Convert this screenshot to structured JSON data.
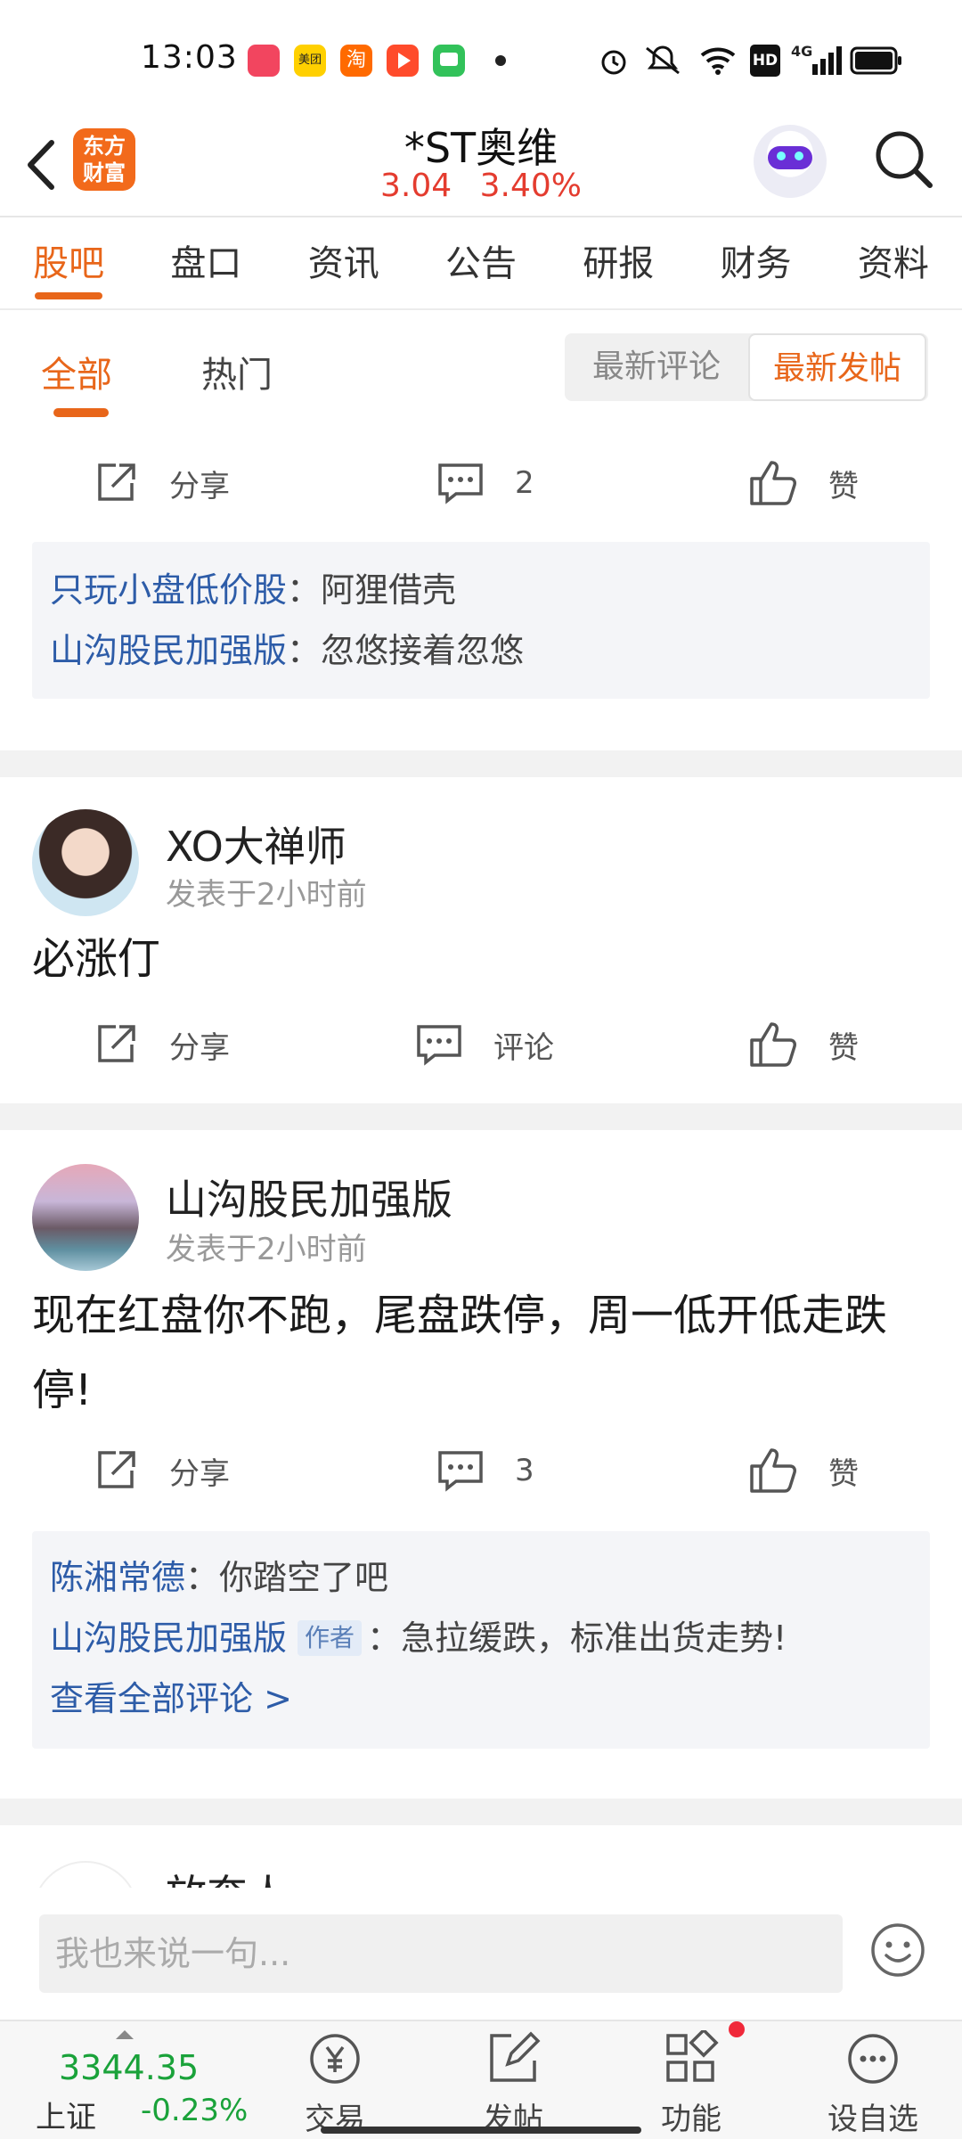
{
  "status_bar": {
    "time": "13:03",
    "apps": [
      {
        "name": "music-app-icon",
        "color": "#f2455f"
      },
      {
        "name": "meituan-app-icon",
        "color": "#ffd000",
        "label": "美团"
      },
      {
        "name": "taobao-app-icon",
        "color": "#ff6a00",
        "label": "淘"
      },
      {
        "name": "video-app-icon",
        "color": "#ff4b2b"
      },
      {
        "name": "chat-app-icon",
        "color": "#32c25a"
      }
    ],
    "hd_label": "HD",
    "network_label": "4G"
  },
  "header": {
    "logo_text_line1": "东方",
    "logo_text_line2": "财富",
    "stock_name": "*ST奥维",
    "price": "3.04",
    "change_pct": "3.40%",
    "price_color": "#e43c2f"
  },
  "tabs": [
    "股吧",
    "盘口",
    "资讯",
    "公告",
    "研报",
    "财务",
    "资料"
  ],
  "subtabs": {
    "all": "全部",
    "hot": "热门",
    "sort_latest_comment": "最新评论",
    "sort_latest_post": "最新发帖"
  },
  "actions": {
    "share": "分享",
    "comment": "评论",
    "like": "赞"
  },
  "feed": {
    "post0": {
      "comment_count": "2",
      "comments": [
        {
          "user": "只玩小盘低价股",
          "text": "：阿狸借壳"
        },
        {
          "user": "山沟股民加强版",
          "text": "：忽悠接着忽悠"
        }
      ]
    },
    "post1": {
      "user": "XO大禅师",
      "time": "发表于2小时前",
      "text": "必涨仃"
    },
    "post2": {
      "user": "山沟股民加强版",
      "time": "发表于2小时前",
      "text": "现在红盘你不跑，尾盘跌停，周一低开低走跌停!",
      "comment_count": "3",
      "comments": [
        {
          "user": "陈湘常德",
          "text": "：你踏空了吧"
        },
        {
          "user": "山沟股民加强版",
          "tag": "作者",
          "text": "：急拉缓跌，标准出货走势!"
        }
      ],
      "view_all": "查看全部评论 >"
    },
    "post3": {
      "user": "放奔人"
    }
  },
  "reply": {
    "placeholder": "我也来说一句..."
  },
  "bottom_nav": {
    "index_value": "3344.35",
    "index_name": "上证",
    "index_change": "-0.23%",
    "trade": "交易",
    "post": "发帖",
    "functions": "功能",
    "add_watch": "设自选"
  }
}
